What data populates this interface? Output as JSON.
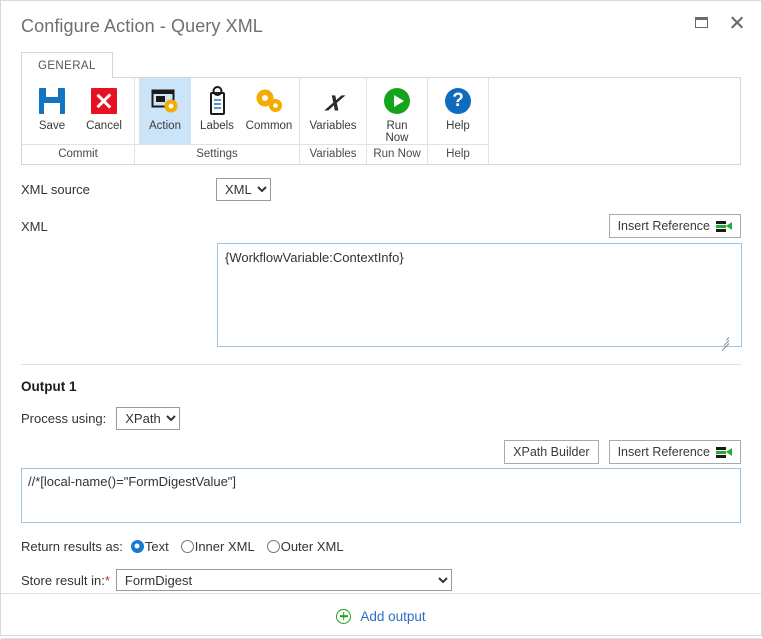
{
  "window": {
    "title": "Configure Action - Query XML",
    "controls": [
      {
        "name": "maximize",
        "icon": "maximize-icon"
      },
      {
        "name": "close",
        "icon": "close-icon"
      }
    ]
  },
  "ribbon": {
    "tabs": [
      {
        "label": "GENERAL",
        "active": true
      }
    ],
    "groups": [
      {
        "label": "Commit",
        "items": [
          {
            "label": "Save",
            "icon": "floppy-disk-icon",
            "active": false
          },
          {
            "label": "Cancel",
            "icon": "red-x-icon",
            "active": false
          }
        ]
      },
      {
        "label": "Settings",
        "items": [
          {
            "label": "Action",
            "icon": "window-gear-icon",
            "active": true
          },
          {
            "label": "Labels",
            "icon": "tag-icon",
            "active": false
          },
          {
            "label": "Common",
            "icon": "gears-icon",
            "active": false
          }
        ]
      },
      {
        "label": "Variables",
        "items": [
          {
            "label": "Variables",
            "icon": "italic-x-icon",
            "active": false
          }
        ]
      },
      {
        "label": "Run Now",
        "items": [
          {
            "label": "Run\nNow",
            "label_line1": "Run",
            "label_line2": "Now",
            "icon": "green-play-icon",
            "active": false
          }
        ]
      },
      {
        "label": "Help",
        "items": [
          {
            "label": "Help",
            "icon": "blue-question-icon",
            "active": false
          }
        ]
      }
    ]
  },
  "form": {
    "xml_source": {
      "label": "XML source",
      "selected": "XML",
      "options": [
        "XML"
      ]
    },
    "xml": {
      "label": "XML",
      "insert_reference_label": "Insert Reference",
      "value": "{WorkflowVariable:ContextInfo}"
    },
    "output": {
      "title": "Output 1",
      "process_using": {
        "label": "Process using:",
        "selected": "XPath",
        "options": [
          "XPath"
        ]
      },
      "xpath_builder_label": "XPath Builder",
      "insert_reference_label": "Insert Reference",
      "xpath_value": "//*[local-name()=\"FormDigestValue\"]",
      "return_results": {
        "label": "Return results as:",
        "options": [
          {
            "label": "Text",
            "checked": true
          },
          {
            "label": "Inner XML",
            "checked": false
          },
          {
            "label": "Outer XML",
            "checked": false
          }
        ]
      },
      "store_result": {
        "label": "Store result in:",
        "required_marker": "*",
        "selected": "FormDigest",
        "options": [
          "FormDigest"
        ]
      }
    },
    "add_output_label": "Add output"
  },
  "colors": {
    "accent_blue": "#1275c4",
    "cancel_red": "#e81123",
    "run_green": "#16a31c",
    "link_blue": "#2b6fc4",
    "add_green": "#17a317",
    "active_tile": "#cce4f7"
  }
}
